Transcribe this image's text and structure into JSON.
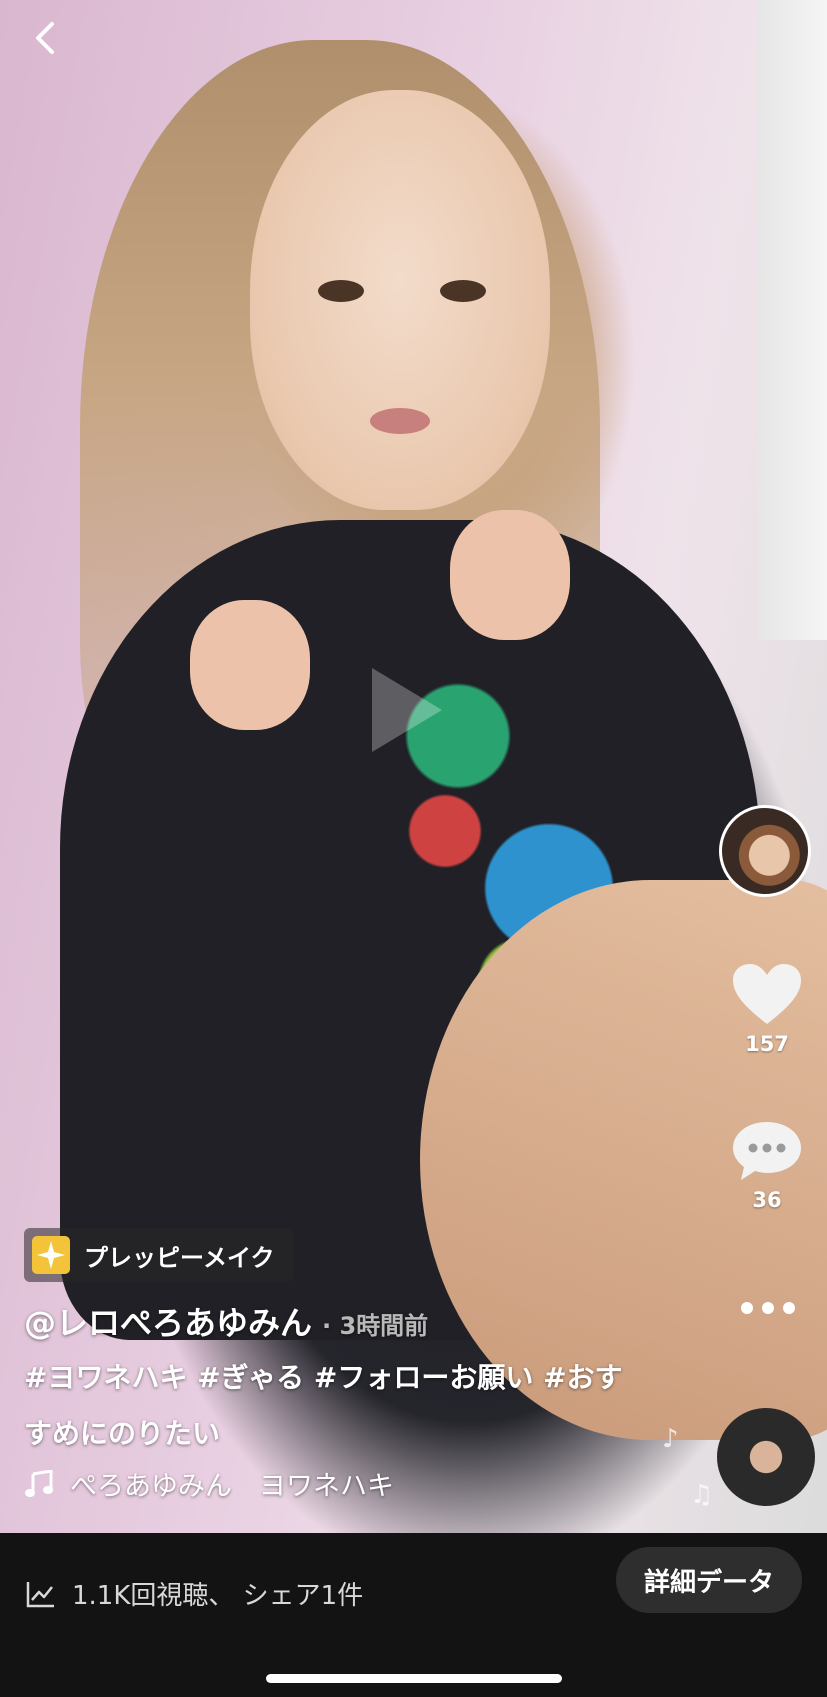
{
  "rail": {
    "like_count": "157",
    "comment_count": "36"
  },
  "effect": {
    "label": "プレッピーメイク"
  },
  "post": {
    "username": "@レロぺろあゆみん",
    "time": "· 3時間前",
    "description": "#ヨワネハキ #ぎゃる #フォローお願い #おすすめにのりたい"
  },
  "music": {
    "text": "ぺろあゆみん　ヨワネハキ"
  },
  "bottom": {
    "stats": "1.1K回視聴、 シェア1件",
    "detail_button": "詳細データ"
  },
  "colors": {
    "bottom_bar": "#131313",
    "effect_icon": "#f3c33a"
  }
}
